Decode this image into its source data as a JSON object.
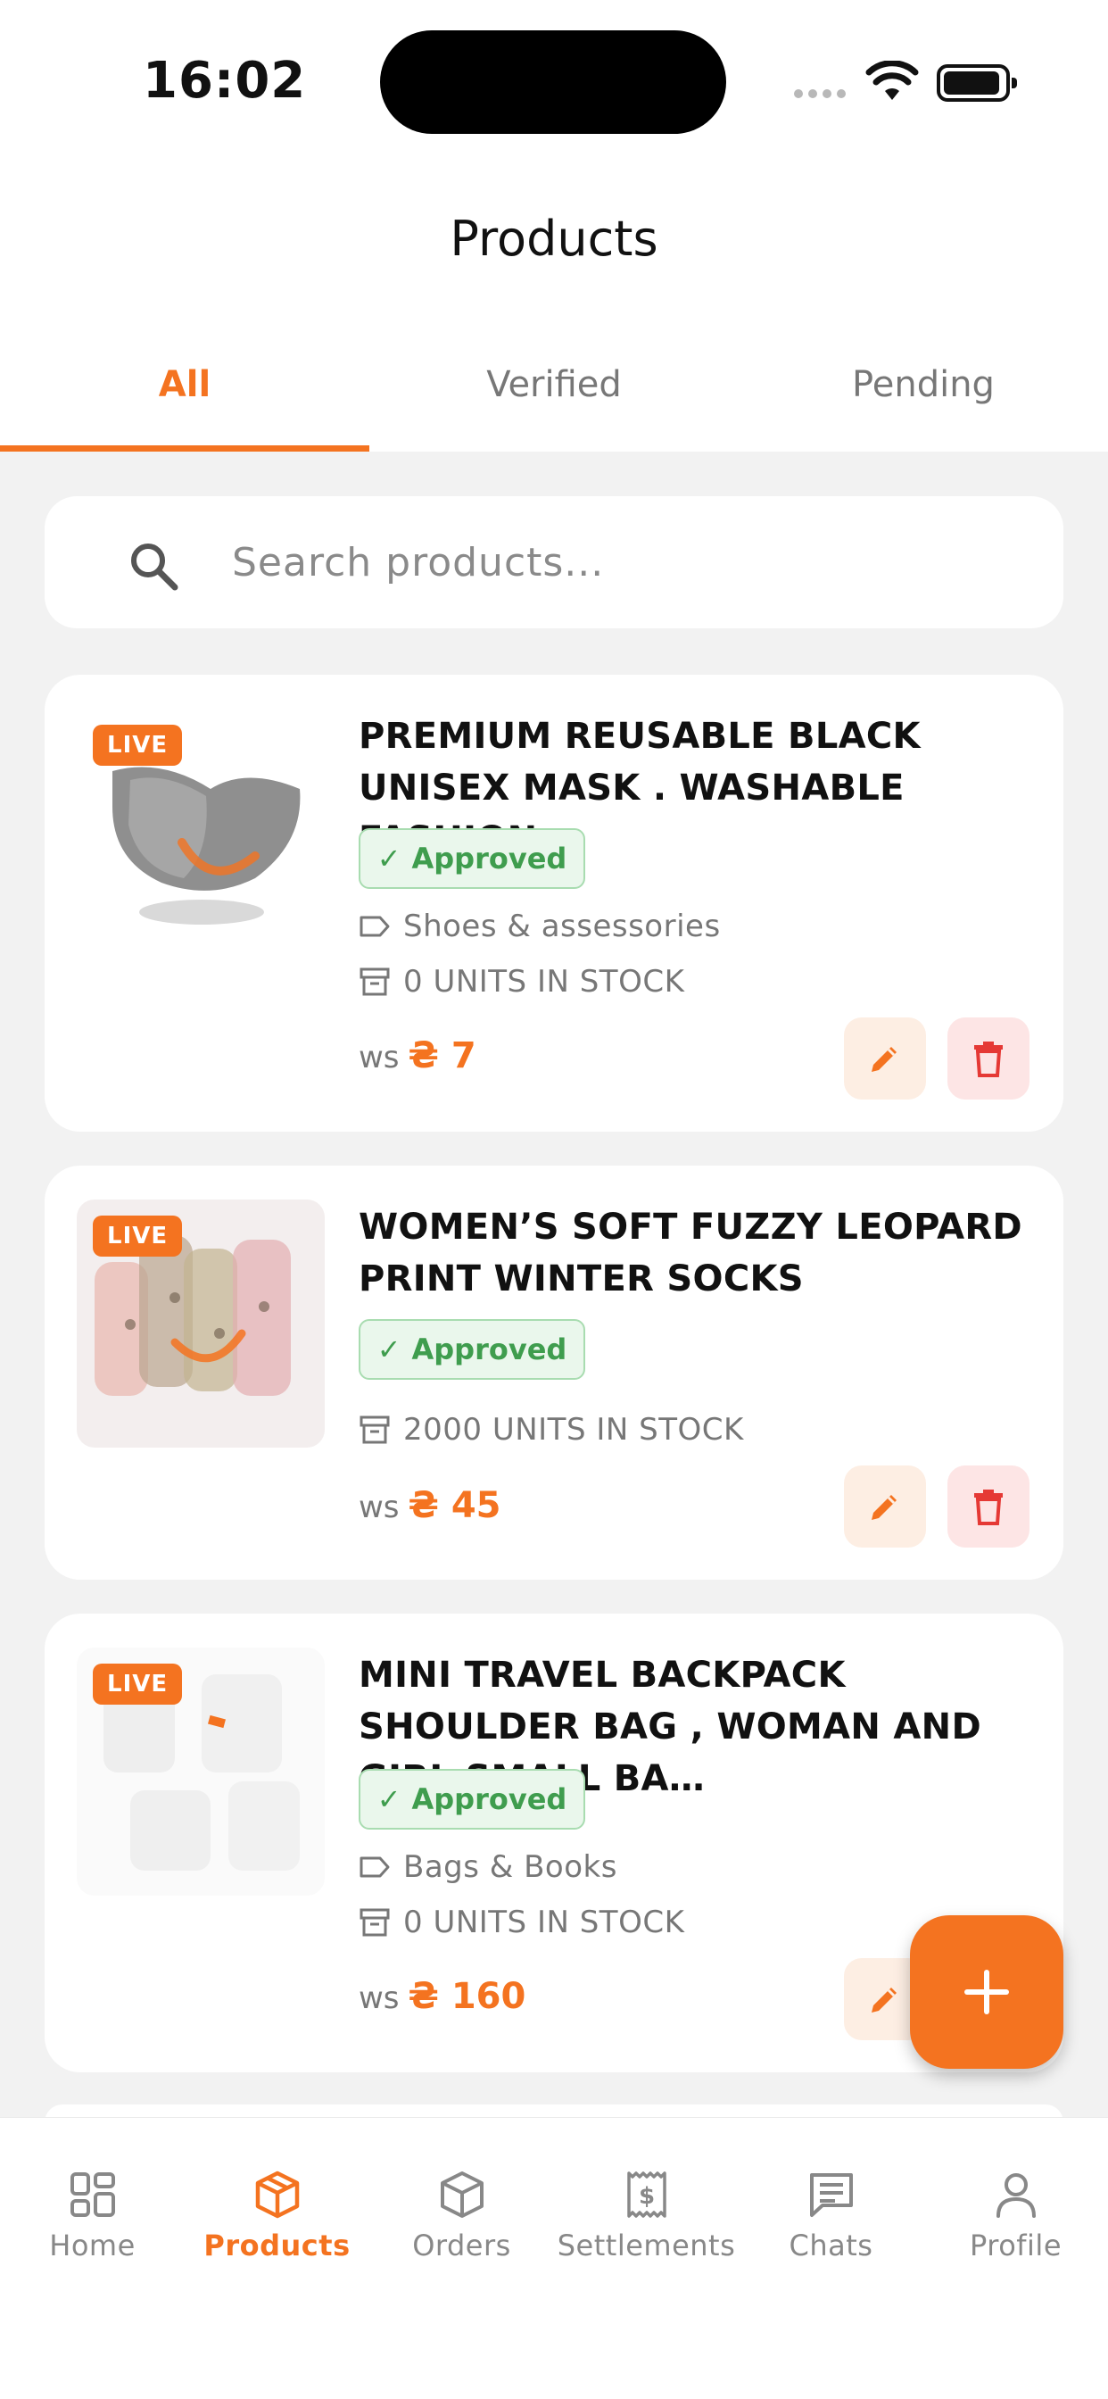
{
  "status_bar": {
    "time": "16:02"
  },
  "header": {
    "title": "Products"
  },
  "tabs": [
    {
      "label": "All",
      "active": true
    },
    {
      "label": "Verified",
      "active": false
    },
    {
      "label": "Pending",
      "active": false
    }
  ],
  "search": {
    "placeholder": "Search products..."
  },
  "products": [
    {
      "badge": "LIVE",
      "title": "PREMIUM REUSABLE BLACK UNISEX MASK . WASHABLE FASHION",
      "status": "Approved",
      "category": "Shoes & assessories",
      "stock": "0 UNITS IN STOCK",
      "price_prefix": "ws",
      "price": "₴ 7"
    },
    {
      "badge": "LIVE",
      "title": "WOMEN’S SOFT FUZZY LEOPARD PRINT WINTER SOCKS",
      "status": "Approved",
      "stock": "2000 UNITS IN STOCK",
      "price_prefix": "ws",
      "price": "₴ 45"
    },
    {
      "badge": "LIVE",
      "title": "MINI TRAVEL BACKPACK SHOULDER BAG , WOMAN AND GIRL SMALL BA…",
      "status": "Approved",
      "category": "Bags & Books",
      "stock": "0 UNITS IN STOCK",
      "price_prefix": "ws",
      "price": "₴ 160"
    }
  ],
  "bottom_nav": [
    {
      "label": "Home",
      "icon": "grid-icon"
    },
    {
      "label": "Products",
      "icon": "box-icon",
      "active": true
    },
    {
      "label": "Orders",
      "icon": "package-icon"
    },
    {
      "label": "Settlements",
      "icon": "receipt-icon"
    },
    {
      "label": "Chats",
      "icon": "chat-icon"
    },
    {
      "label": "Profile",
      "icon": "user-icon"
    }
  ],
  "colors": {
    "accent": "#f47320",
    "approved": "#3f9d4e",
    "delete": "#e53935"
  }
}
